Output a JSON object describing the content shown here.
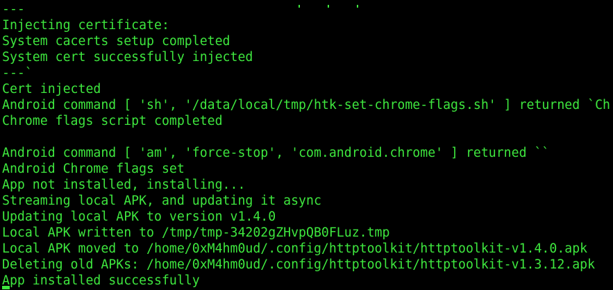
{
  "colors": {
    "background": "#000000",
    "text": "#3ee63e"
  },
  "terminal": {
    "lines": [
      "---",
      "Injecting certificate:",
      "System cacerts setup completed",
      "System cert successfully injected",
      "---`",
      "Cert injected",
      "Android command [ 'sh', '/data/local/tmp/htk-set-chrome-flags.sh' ] returned `Ch",
      "Chrome flags script completed",
      "",
      "Android command [ 'am', 'force-stop', 'com.android.chrome' ] returned ``",
      "Android Chrome flags set",
      "App not installed, installing...",
      "Streaming local APK, and updating it async",
      "Updating local APK to version v1.4.0",
      "Local APK written to /tmp/tmp-34202gZHvpQB0FLuz.tmp",
      "Local APK moved to /home/0xM4hm0ud/.config/httptoolkit/httptoolkit-v1.4.0.apk",
      "Deleting old APKs: /home/0xM4hm0ud/.config/httptoolkit/httptoolkit-v1.3.12.apk",
      "App installed successfully"
    ]
  }
}
